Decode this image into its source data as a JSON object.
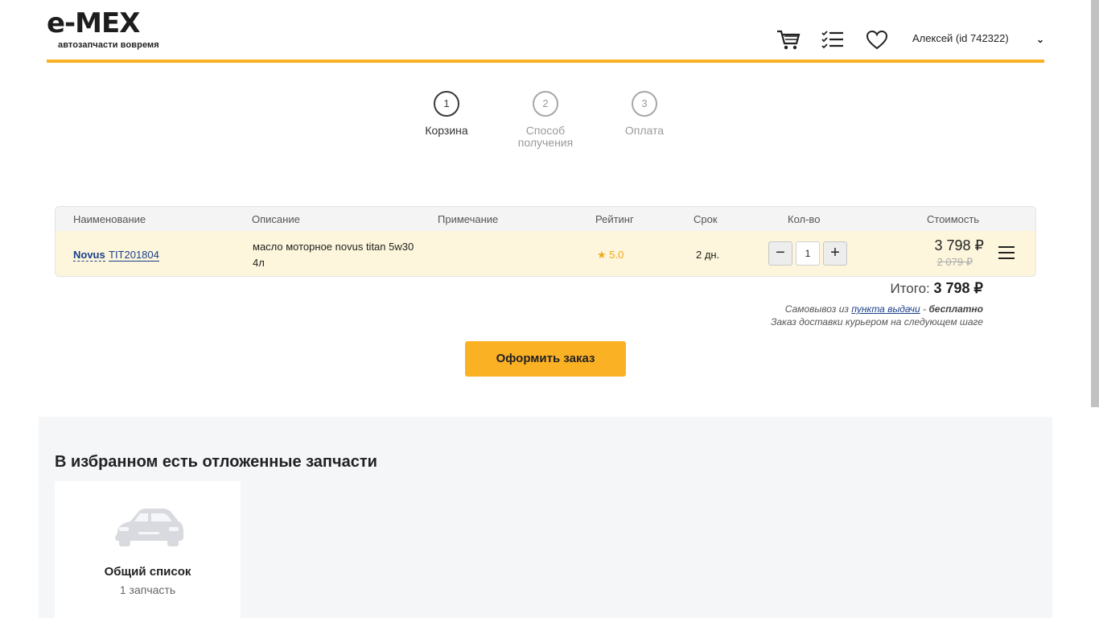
{
  "header": {
    "logo_text": "e-MEX",
    "logo_tagline": "автозапчасти вовремя",
    "user_label": "Алексей  (id 742322)"
  },
  "stepper": [
    {
      "number": "1",
      "label": "Корзина"
    },
    {
      "number": "2",
      "label": "Способ получения"
    },
    {
      "number": "3",
      "label": "Оплата"
    }
  ],
  "table": {
    "columns": [
      "Наименование",
      "Описание",
      "Примечание",
      "Рейтинг",
      "Срок",
      "Кол-во",
      "Стоимость"
    ],
    "rows": [
      {
        "brand": "Novus",
        "article": "TIT201804",
        "description": "масло моторное novus titan 5w30 4л",
        "note": "",
        "rating": "5.0",
        "term": "2 дн.",
        "quantity": "1",
        "price": "3 798 ₽",
        "old_price": "2 079 ₽"
      }
    ]
  },
  "summary": {
    "total_label": "Итого:",
    "total_value": "3 798 ₽",
    "pickup_prefix": "Самовывоз из",
    "pickup_link": "пункта выдачи",
    "pickup_suffix": "-",
    "pickup_free": "бесплатно",
    "courier_note": "Заказ доставки курьером на следующем шаге"
  },
  "checkout_button": "Оформить заказ",
  "favorites": {
    "title": "В избранном есть отложенные запчасти",
    "cards": [
      {
        "name": "Общий список",
        "count": "1 запчасть"
      }
    ]
  },
  "colors": {
    "accent": "#fbb124",
    "link": "#1b3f8a",
    "row_highlight": "#fdf6dc"
  },
  "icons": {
    "cart": "cart-icon",
    "list": "checklist-icon",
    "favorites": "heart-icon",
    "dropdown": "chevron-down-icon",
    "rating": "star-icon",
    "row_menu": "hamburger-menu-icon",
    "car": "car-icon"
  }
}
